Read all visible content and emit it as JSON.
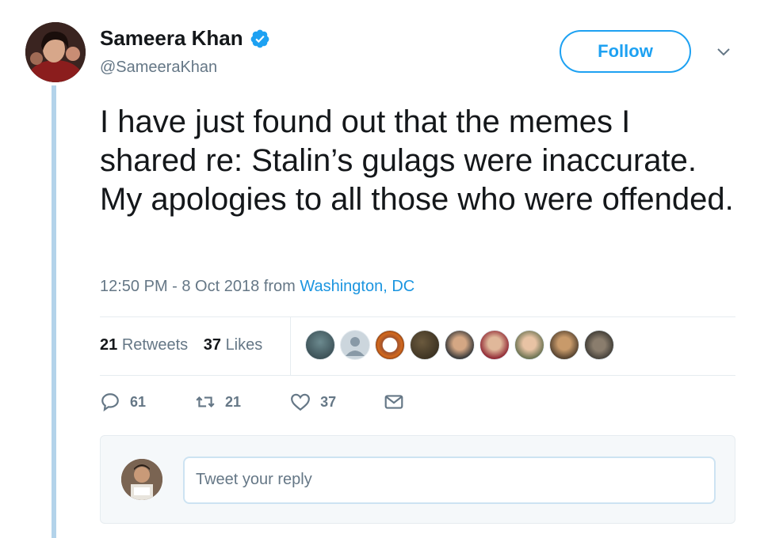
{
  "author": {
    "name": "Sameera Khan",
    "handle": "@SameeraKhan",
    "verified_icon": "verified-badge-icon"
  },
  "follow_label": "Follow",
  "tweet": {
    "text": "I have just found out that the memes I shared re: Stalin’s gulags were inaccurate. My apologies to all those who were offended.",
    "time": "12:50 PM - 8 Oct 2018 from ",
    "location": "Washington, DC"
  },
  "stats": {
    "retweets_count": "21",
    "retweets_label": "Retweets",
    "likes_count": "37",
    "likes_label": "Likes"
  },
  "actions": {
    "reply_count": "61",
    "retweet_count": "21",
    "like_count": "37"
  },
  "reply": {
    "placeholder": "Tweet your reply"
  },
  "colors": {
    "accent": "#1da1f2",
    "muted": "#657786",
    "thread_line": "#b3d3ea"
  }
}
